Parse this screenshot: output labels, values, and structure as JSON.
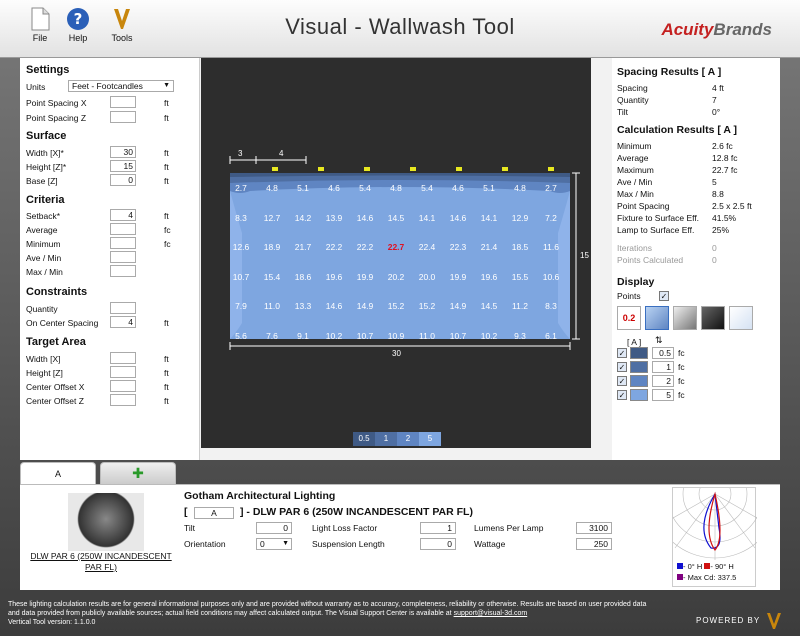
{
  "toolbar": {
    "file": "File",
    "help": "Help",
    "tools": "Tools"
  },
  "title": "Visual - Wallwash Tool",
  "logo": {
    "part1": "Acuity",
    "part2": "Brands"
  },
  "settings": {
    "header": "Settings",
    "units_label": "Units",
    "units_value": "Feet - Footcandles",
    "point_spacing_x": "Point Spacing X",
    "point_spacing_z": "Point Spacing Z",
    "ft": "ft",
    "fc": "fc"
  },
  "surface": {
    "header": "Surface",
    "width_label": "Width  [X]*",
    "width": "30",
    "height_label": "Height [Z]*",
    "height": "15",
    "base_label": "Base  [Z]",
    "base": "0"
  },
  "criteria": {
    "header": "Criteria",
    "setback_label": "Setback*",
    "setback": "4",
    "average": "Average",
    "minimum": "Minimum",
    "ave_min": "Ave / Min",
    "max_min": "Max / Min"
  },
  "constraints": {
    "header": "Constraints",
    "quantity": "Quantity",
    "on_center_label": "On Center Spacing",
    "on_center": "4"
  },
  "target": {
    "header": "Target Area",
    "width": "Width [X]",
    "height": "Height [Z]",
    "cx": "Center Offset X",
    "cz": "Center Offset Z"
  },
  "grid": {
    "rows": [
      [
        "2.7",
        "4.8",
        "5.1",
        "4.6",
        "5.4",
        "4.8",
        "5.4",
        "4.6",
        "5.1",
        "4.8",
        "2.7"
      ],
      [
        "8.3",
        "12.7",
        "14.2",
        "13.9",
        "14.6",
        "14.5",
        "14.1",
        "14.6",
        "14.1",
        "12.9",
        "7.2"
      ],
      [
        "12.6",
        "18.9",
        "21.7",
        "22.2",
        "22.2",
        "22.7",
        "22.4",
        "22.3",
        "21.4",
        "18.5",
        "11.6"
      ],
      [
        "10.7",
        "15.4",
        "18.6",
        "19.6",
        "19.9",
        "20.2",
        "20.0",
        "19.9",
        "19.6",
        "15.5",
        "10.6"
      ],
      [
        "7.9",
        "11.0",
        "13.3",
        "14.6",
        "14.9",
        "15.2",
        "15.2",
        "14.9",
        "14.5",
        "11.2",
        "8.3"
      ],
      [
        "5.6",
        "7.6",
        "9.1",
        "10.2",
        "10.7",
        "10.9",
        "11.0",
        "10.7",
        "10.2",
        "9.3",
        "6.1"
      ]
    ],
    "dim_top_1": "3",
    "dim_top_2": "4",
    "dim_right": "15",
    "dim_bottom": "30",
    "legend": [
      "0.5",
      "1",
      "2",
      "5"
    ],
    "legend_colors": [
      "#3f5a85",
      "#4f6fa3",
      "#5f85c2",
      "#7ea6e0"
    ]
  },
  "spacing": {
    "header": "Spacing Results  [ A ]",
    "spacing": "Spacing",
    "spacing_v": "4  ft",
    "quantity": "Quantity",
    "quantity_v": "7",
    "tilt": "Tilt",
    "tilt_v": "0°"
  },
  "calc": {
    "header": "Calculation Results  [ A ]",
    "rows": [
      [
        "Minimum",
        "2.6  fc"
      ],
      [
        "Average",
        "12.8  fc"
      ],
      [
        "Maximum",
        "22.7  fc"
      ],
      [
        "Ave / Min",
        "5"
      ],
      [
        "Max / Min",
        "8.8"
      ],
      [
        "Point Spacing",
        "2.5 x 2.5  ft"
      ],
      [
        "Fixture to Surface Eff.",
        "41.5%"
      ],
      [
        "Lamp to Surface Eff.",
        "25%"
      ]
    ],
    "iterations": "Iterations",
    "iterations_v": "0",
    "points_calc": "Points Calculated",
    "points_calc_v": "0"
  },
  "display": {
    "header": "Display",
    "points": "Points",
    "label_icon": "0.2",
    "a_label": "[ A ]",
    "levels": [
      "0.5",
      "1",
      "2",
      "5"
    ],
    "level_colors": [
      "#3f5a85",
      "#4f6fa3",
      "#5f85c2",
      "#7ea6e0"
    ]
  },
  "tabs": {
    "a": "A"
  },
  "luminaire": {
    "caption": "DLW PAR 6 (250W INCANDESCENT PAR FL)",
    "maker": "Gotham Architectural Lighting",
    "bracket_open": "[",
    "tag": "A",
    "name": "] - DLW PAR 6 (250W INCANDESCENT PAR FL)",
    "tilt": "Tilt",
    "tilt_v": "0",
    "orientation": "Orientation",
    "orientation_v": "0",
    "llf": "Light Loss Factor",
    "llf_v": "1",
    "susp": "Suspension Length",
    "susp_v": "0",
    "lumens": "Lumens Per Lamp",
    "lumens_v": "3100",
    "wattage": "Wattage",
    "wattage_v": "250"
  },
  "polar": {
    "h0": "- 0° H",
    "h90": "- 90° H",
    "maxcd": "- Max Cd: 337.5"
  },
  "footer": {
    "text": "These lighting calculation results are for general informational purposes only and are provided without warranty as to accuracy, completeness, reliability or otherwise. Results are based on user provided data and data provided from publicly available sources; actual field conditions may affect calculated output. The Visual Support Center is available at",
    "link": "support@visual-3d.com",
    "version": "Vertical Tool version: 1.1.0.0",
    "powered": "POWERED BY"
  }
}
